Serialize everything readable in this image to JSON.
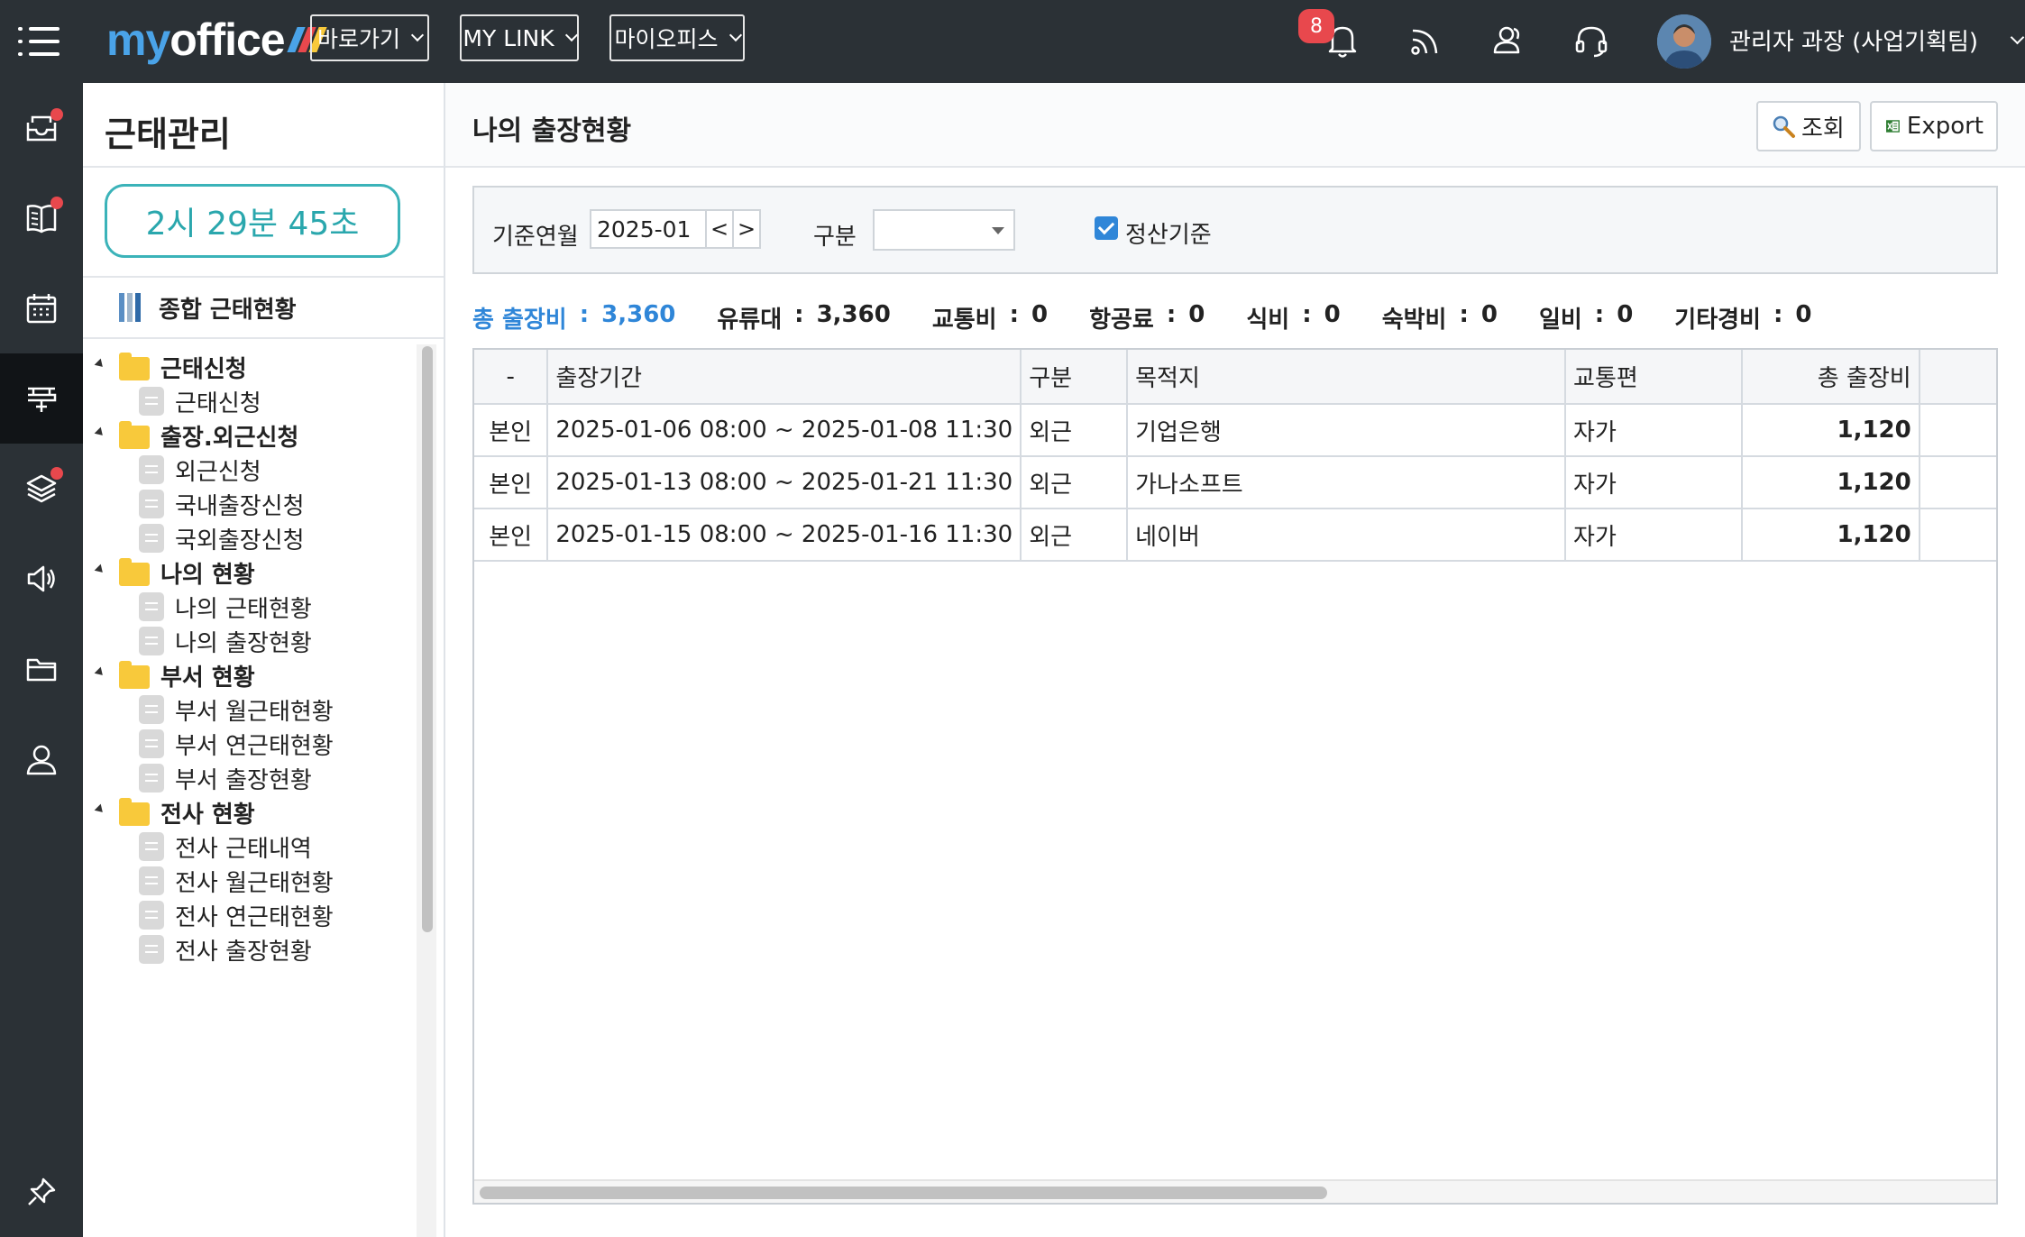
{
  "app": {
    "logo_my": "my",
    "logo_office": "office",
    "logo_bar_colors": [
      "#4aa3e8",
      "#e8484d",
      "#f8c93b"
    ]
  },
  "topbar": {
    "menus": [
      {
        "label": "바로가기"
      },
      {
        "label": "MY LINK"
      },
      {
        "label": "마이오피스"
      }
    ],
    "notification_count": "8",
    "icons": [
      "bell-icon",
      "rss-icon",
      "people-icon",
      "headset-icon"
    ],
    "user_name": "관리자 과장 (사업기획팀)"
  },
  "rail": {
    "items": [
      "mail-icon",
      "board-icon",
      "calendar-icon",
      "attendance-icon",
      "layers-icon",
      "speaker-icon",
      "folder-icon",
      "person-icon",
      "pin-icon"
    ],
    "active": "attendance-icon"
  },
  "sidebar": {
    "title": "근태관리",
    "timer": "2시 29분 45초",
    "summary_link": "종합 근태현황",
    "tree": [
      {
        "type": "folder",
        "label": "근태신청"
      },
      {
        "type": "leaf",
        "label": "근태신청"
      },
      {
        "type": "folder",
        "label": "출장.외근신청"
      },
      {
        "type": "leaf",
        "label": "외근신청"
      },
      {
        "type": "leaf",
        "label": "국내출장신청"
      },
      {
        "type": "leaf",
        "label": "국외출장신청"
      },
      {
        "type": "folder",
        "label": "나의 현황"
      },
      {
        "type": "leaf",
        "label": "나의 근태현황"
      },
      {
        "type": "leaf",
        "label": "나의 출장현황"
      },
      {
        "type": "folder",
        "label": "부서 현황"
      },
      {
        "type": "leaf",
        "label": "부서 월근태현황"
      },
      {
        "type": "leaf",
        "label": "부서 연근태현황"
      },
      {
        "type": "leaf",
        "label": "부서 출장현황"
      },
      {
        "type": "folder",
        "label": "전사 현황"
      },
      {
        "type": "leaf",
        "label": "전사 근태내역"
      },
      {
        "type": "leaf",
        "label": "전사 월근태현황"
      },
      {
        "type": "leaf",
        "label": "전사 연근태현황"
      },
      {
        "type": "leaf",
        "label": "전사 출장현황"
      }
    ]
  },
  "main": {
    "title": "나의 출장현황",
    "search_button": "조회",
    "export_button": "Export",
    "filters": {
      "month_label": "기준연월",
      "month_value": "2025-01",
      "prev": "<",
      "next": ">",
      "type_label": "구분",
      "type_value": "",
      "settle_label": "정산기준",
      "settle_checked": true
    },
    "totals": [
      {
        "label": "총 출장비",
        "value": "3,360"
      },
      {
        "label": "유류대",
        "value": "3,360"
      },
      {
        "label": "교통비",
        "value": "0"
      },
      {
        "label": "항공료",
        "value": "0"
      },
      {
        "label": "식비",
        "value": "0"
      },
      {
        "label": "숙박비",
        "value": "0"
      },
      {
        "label": "일비",
        "value": "0"
      },
      {
        "label": "기타경비",
        "value": "0"
      }
    ],
    "table": {
      "columns": [
        "-",
        "출장기간",
        "구분",
        "목적지",
        "교통편",
        "총 출장비",
        ""
      ],
      "rows": [
        [
          "본인",
          "2025-01-06 08:00 ~ 2025-01-08 11:30",
          "외근",
          "기업은행",
          "자가",
          "1,120"
        ],
        [
          "본인",
          "2025-01-13 08:00 ~ 2025-01-21 11:30",
          "외근",
          "가나소프트",
          "자가",
          "1,120"
        ],
        [
          "본인",
          "2025-01-15 08:00 ~ 2025-01-16 11:30",
          "외근",
          "네이버",
          "자가",
          "1,120"
        ]
      ]
    }
  }
}
